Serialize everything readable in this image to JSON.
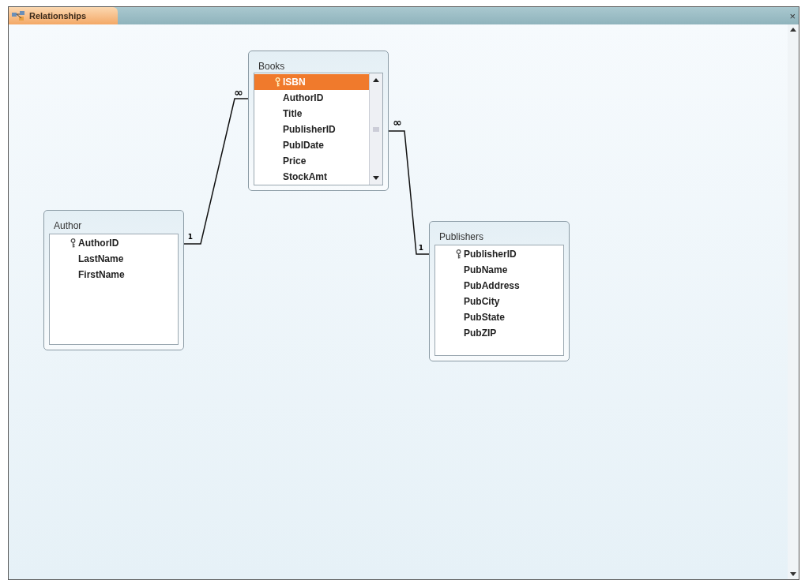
{
  "window": {
    "tab": "Relationships",
    "close": "×"
  },
  "tables": [
    {
      "name": "Books",
      "fields": [
        {
          "name": "ISBN",
          "primary_key": true,
          "selected": true
        },
        {
          "name": "AuthorID",
          "primary_key": false,
          "selected": false
        },
        {
          "name": "Title",
          "primary_key": false,
          "selected": false
        },
        {
          "name": "PublisherID",
          "primary_key": false,
          "selected": false
        },
        {
          "name": "PublDate",
          "primary_key": false,
          "selected": false
        },
        {
          "name": "Price",
          "primary_key": false,
          "selected": false
        },
        {
          "name": "StockAmt",
          "primary_key": false,
          "selected": false
        }
      ]
    },
    {
      "name": "Author",
      "fields": [
        {
          "name": "AuthorID",
          "primary_key": true,
          "selected": false
        },
        {
          "name": "LastName",
          "primary_key": false,
          "selected": false
        },
        {
          "name": "FirstName",
          "primary_key": false,
          "selected": false
        }
      ]
    },
    {
      "name": "Publishers",
      "fields": [
        {
          "name": "PublisherID",
          "primary_key": true,
          "selected": false
        },
        {
          "name": "PubName",
          "primary_key": false,
          "selected": false
        },
        {
          "name": "PubAddress",
          "primary_key": false,
          "selected": false
        },
        {
          "name": "PubCity",
          "primary_key": false,
          "selected": false
        },
        {
          "name": "PubState",
          "primary_key": false,
          "selected": false
        },
        {
          "name": "PubZIP",
          "primary_key": false,
          "selected": false
        }
      ]
    }
  ],
  "relationships": [
    {
      "one_label": "1",
      "many_label": "∞"
    },
    {
      "one_label": "1",
      "many_label": "∞"
    }
  ]
}
